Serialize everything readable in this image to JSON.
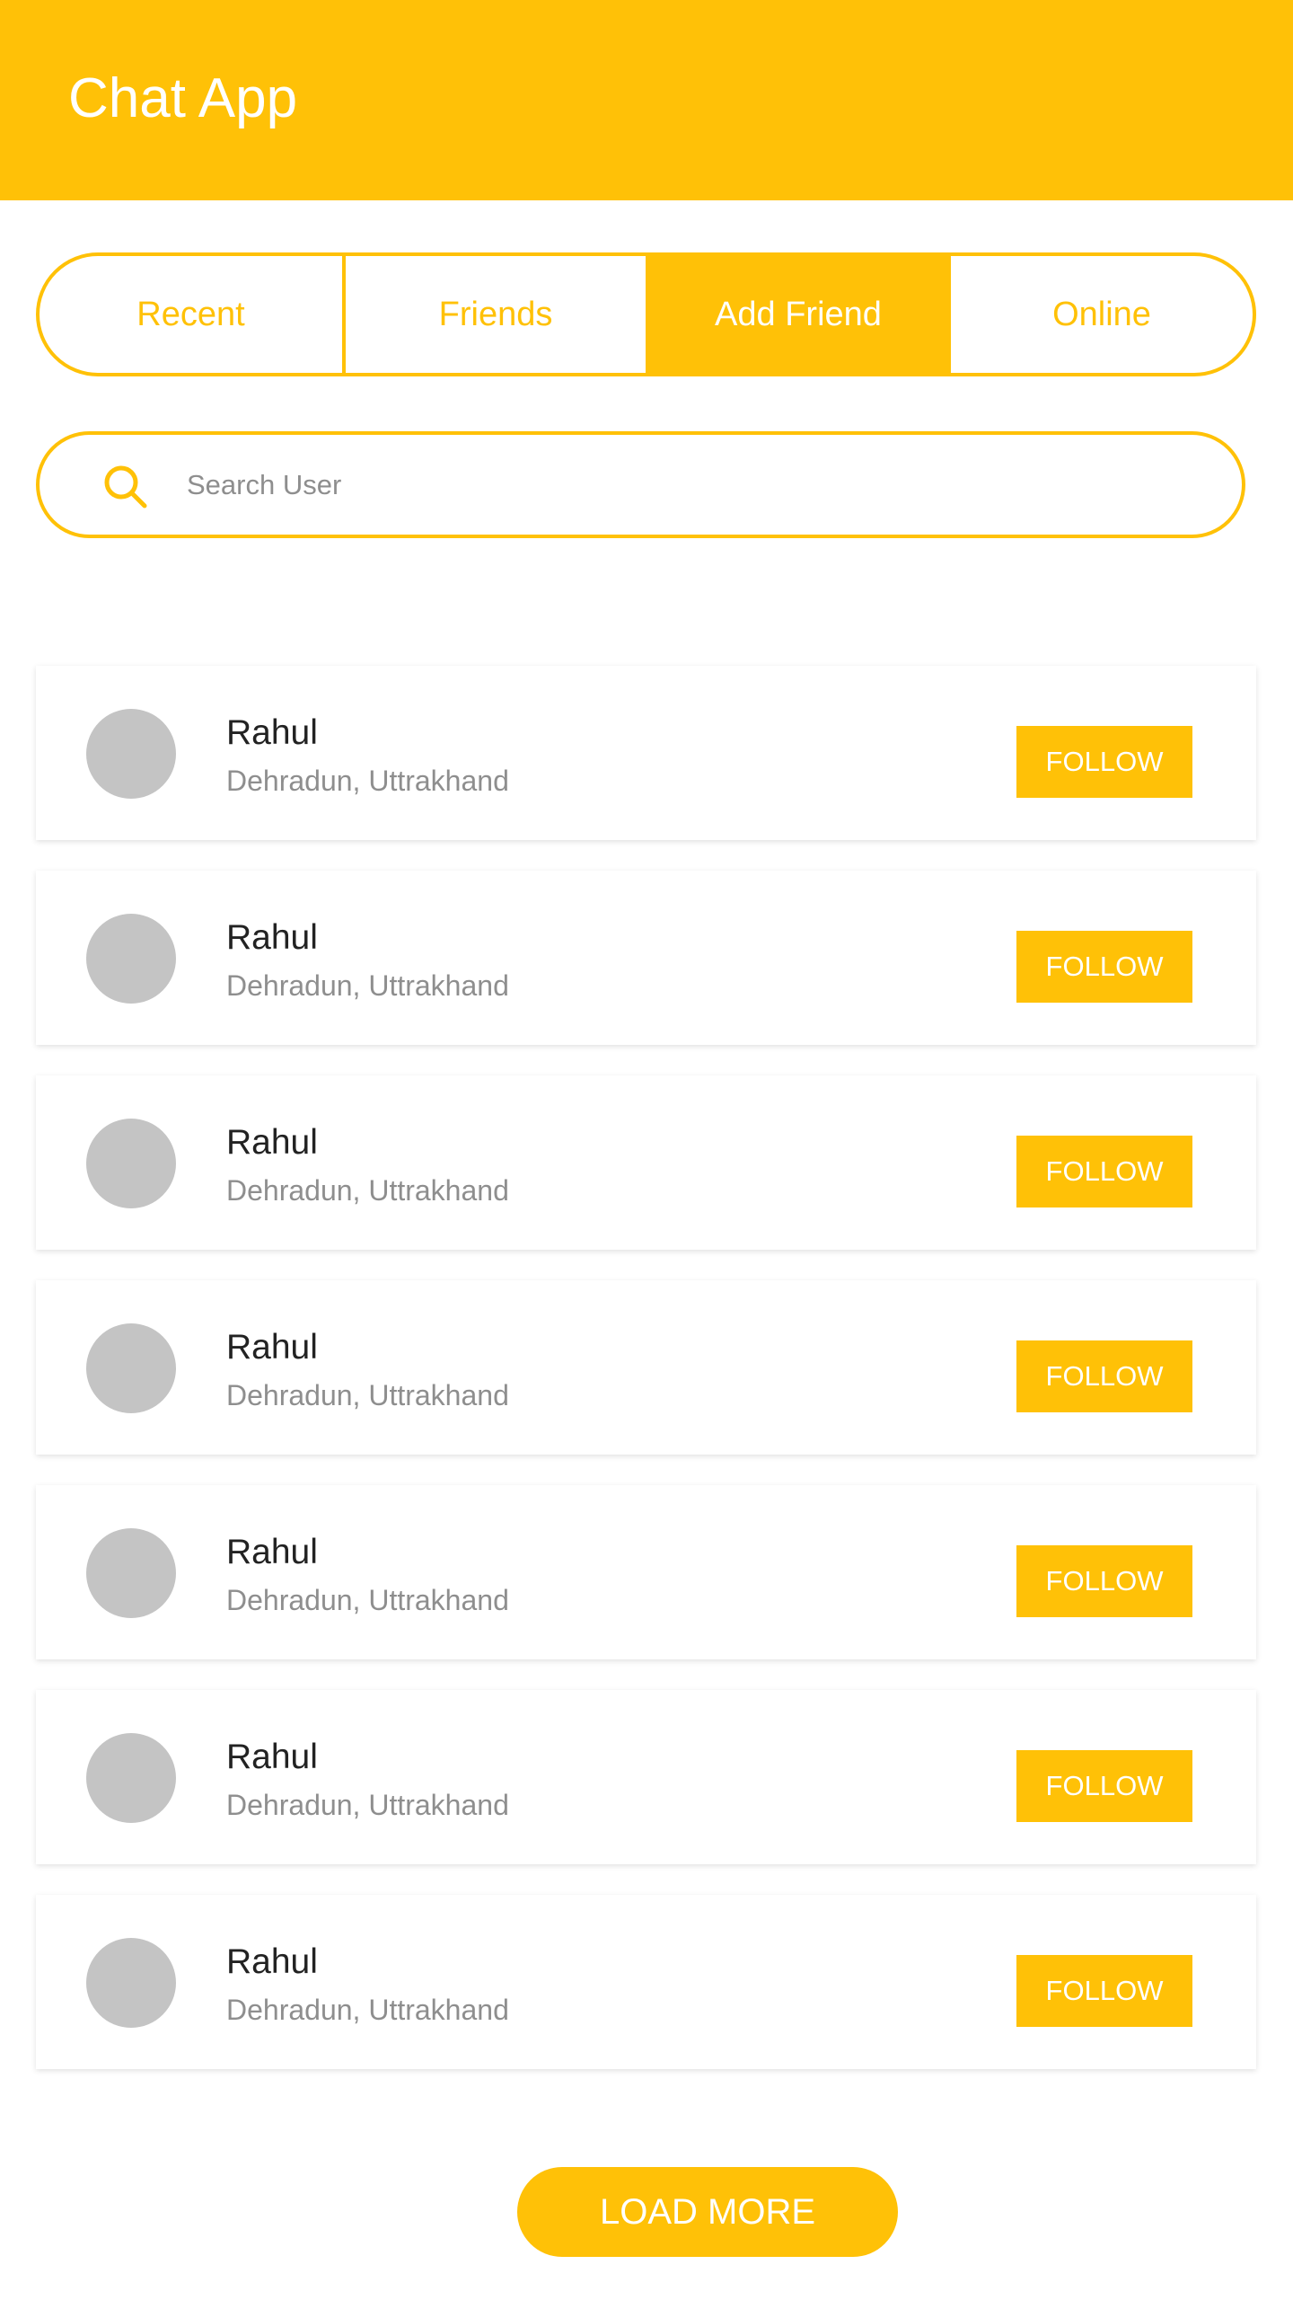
{
  "app": {
    "title": "Chat App"
  },
  "tabs": [
    {
      "label": "Recent",
      "active": false
    },
    {
      "label": "Friends",
      "active": false
    },
    {
      "label": "Add Friend",
      "active": true
    },
    {
      "label": "Online",
      "active": false
    }
  ],
  "search": {
    "placeholder": "Search User",
    "icon": "search-icon"
  },
  "users": [
    {
      "name": "Rahul",
      "location": "Dehradun, Uttrakhand",
      "action": "FOLLOW"
    },
    {
      "name": "Rahul",
      "location": "Dehradun, Uttrakhand",
      "action": "FOLLOW"
    },
    {
      "name": "Rahul",
      "location": "Dehradun, Uttrakhand",
      "action": "FOLLOW"
    },
    {
      "name": "Rahul",
      "location": "Dehradun, Uttrakhand",
      "action": "FOLLOW"
    },
    {
      "name": "Rahul",
      "location": "Dehradun, Uttrakhand",
      "action": "FOLLOW"
    },
    {
      "name": "Rahul",
      "location": "Dehradun, Uttrakhand",
      "action": "FOLLOW"
    },
    {
      "name": "Rahul",
      "location": "Dehradun, Uttrakhand",
      "action": "FOLLOW"
    }
  ],
  "load_more_label": "LOAD MORE",
  "colors": {
    "accent": "#FFC107",
    "avatar": "#C4C4C4"
  }
}
